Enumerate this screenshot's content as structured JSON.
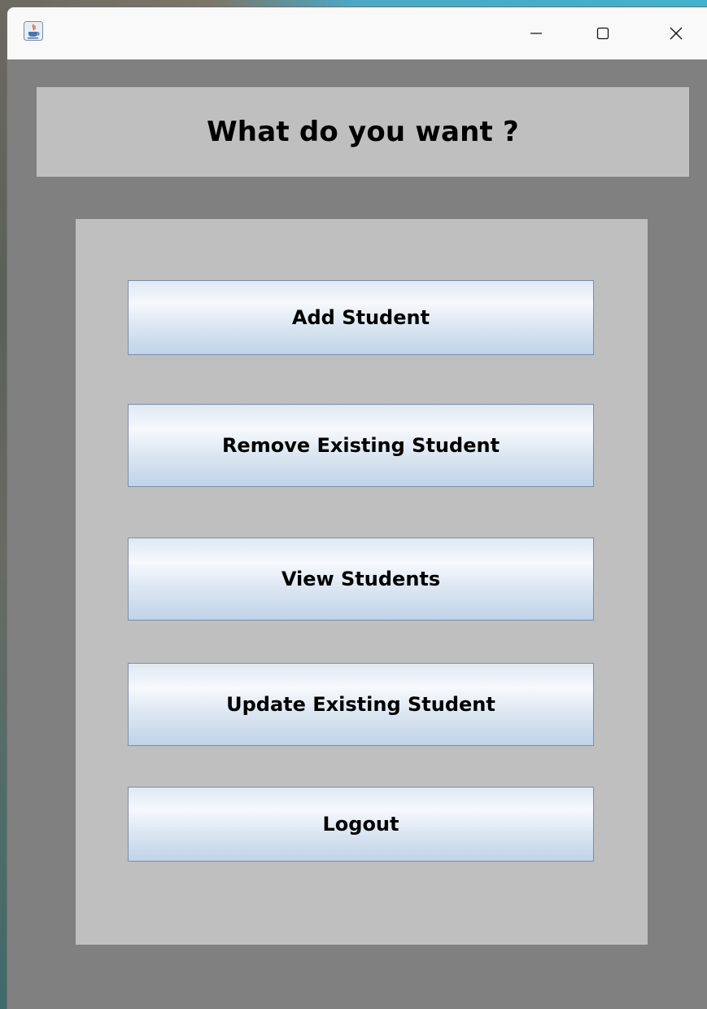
{
  "window": {
    "title": "",
    "controls": {
      "minimize_icon": "minimize-icon",
      "maximize_icon": "maximize-icon",
      "close_icon": "close-icon"
    },
    "app_icon": "java-coffee-cup-icon"
  },
  "header": {
    "title": "What do you want ?"
  },
  "menu": {
    "buttons": [
      {
        "label": "Add Student"
      },
      {
        "label": "Remove Existing Student"
      },
      {
        "label": "View Students"
      },
      {
        "label": "Update Existing Student"
      },
      {
        "label": "Logout"
      }
    ]
  },
  "colors": {
    "window_background": "#808080",
    "panel_background": "#bfbfbf",
    "button_gradient_light": "#f6f9fd",
    "button_gradient_dark": "#bfd3e8",
    "button_border": "#7a8ea8",
    "titlebar": "#f9f9f9"
  }
}
